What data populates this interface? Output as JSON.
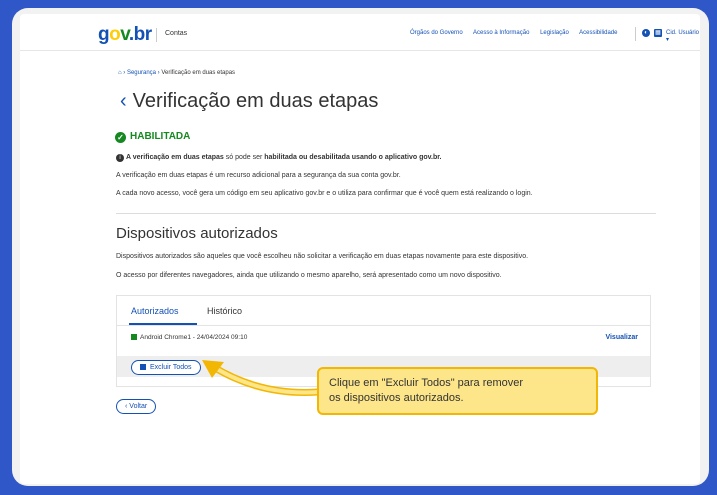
{
  "header": {
    "logo": {
      "g": "g",
      "o": "o",
      "v": "v",
      "br": ".br"
    },
    "section": "Contas",
    "links": [
      "Órgãos do Governo",
      "Acesso à Informação",
      "Legislação",
      "Acessibilidade"
    ],
    "user_label": "Cid. Usuário ▾"
  },
  "breadcrumb": {
    "item1": "Segurança",
    "current": "Verificação em duas etapas"
  },
  "page": {
    "title": "Verificação em duas etapas",
    "status": "HABILITADA",
    "info_prefix": "A verificação em duas etapas",
    "info_middle": " só pode ser ",
    "info_bold": "habilitada ou desabilitada usando o aplicativo gov.br.",
    "desc1": "A verificação em duas etapas é um recurso adicional para a segurança da sua conta gov.br.",
    "desc2": "A cada novo acesso, você gera um código em seu aplicativo gov.br e o utiliza para confirmar que é você quem está realizando o login."
  },
  "devices": {
    "heading": "Dispositivos autorizados",
    "desc1": "Dispositivos autorizados são aqueles que você escolheu não solicitar a verificação em duas etapas novamente para este dispositivo.",
    "desc2": "O acesso por diferentes navegadores, ainda que utilizando o mesmo aparelho, será apresentado como um novo dispositivo.",
    "tabs": [
      "Autorizados",
      "Histórico"
    ],
    "device_entry": "Android Chrome1 - 24/04/2024 09:10",
    "view_link": "Visualizar",
    "delete_all": "Excluir Todos"
  },
  "back_button": "Voltar",
  "callout": {
    "line1": "Clique em \"Excluir Todos\" para remover",
    "line2": "os dispositivos autorizados."
  },
  "colors": {
    "brand_blue": "#1351b4",
    "success_green": "#168821",
    "callout_yellow": "#fde68a",
    "frame_blue": "#2f57c7"
  }
}
